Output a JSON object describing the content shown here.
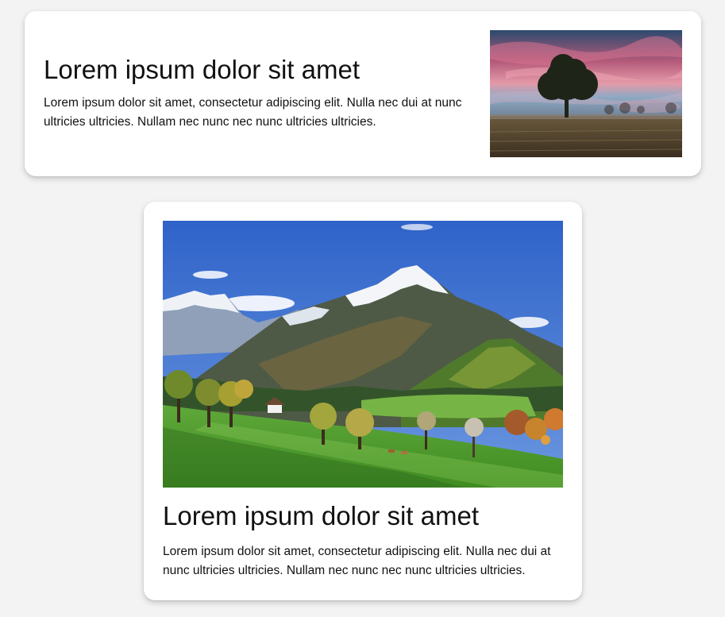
{
  "cards": [
    {
      "layout": "horizontal",
      "title": "Lorem ipsum dolor sit amet",
      "body": "Lorem ipsum dolor sit amet, consectetur adipiscing elit. Nulla nec dui at nunc ultricies ultricies. Nullam nec nunc nec nunc ultricies ultricies.",
      "image": "tree-sunset-photo"
    },
    {
      "layout": "vertical",
      "title": "Lorem ipsum dolor sit amet",
      "body": "Lorem ipsum dolor sit amet, consectetur adipiscing elit. Nulla nec dui at nunc ultricies ultricies. Nullam nec nunc nec nunc ultricies ultricies.",
      "image": "mountain-meadow-photo"
    }
  ],
  "colors": {
    "page_background": "#f3f3f3",
    "card_background": "#ffffff",
    "text": "#111111"
  }
}
